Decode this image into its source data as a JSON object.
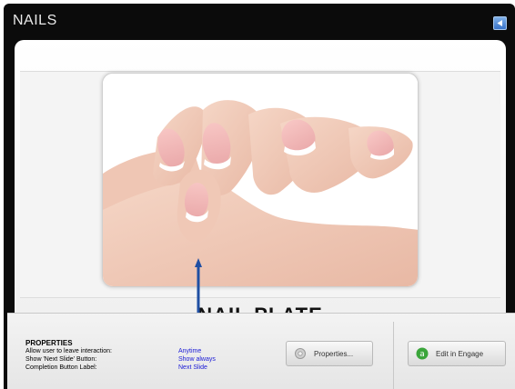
{
  "window": {
    "title": "NAILS"
  },
  "slide": {
    "caption": "NAIL PLATE"
  },
  "properties": {
    "heading": "PROPERTIES",
    "rows": [
      {
        "label": "Allow user to leave interaction:",
        "value": "Anytime"
      },
      {
        "label": "Show 'Next Slide' Button:",
        "value": "Show always"
      },
      {
        "label": "Completion Button Label:",
        "value": "Next Slide"
      }
    ],
    "properties_button": "Properties...",
    "edit_button": "Edit in Engage"
  },
  "colors": {
    "accent_blue": "#1a1ad6",
    "engage_green": "#3aa53a",
    "arrow_blue": "#1f4fa3"
  }
}
